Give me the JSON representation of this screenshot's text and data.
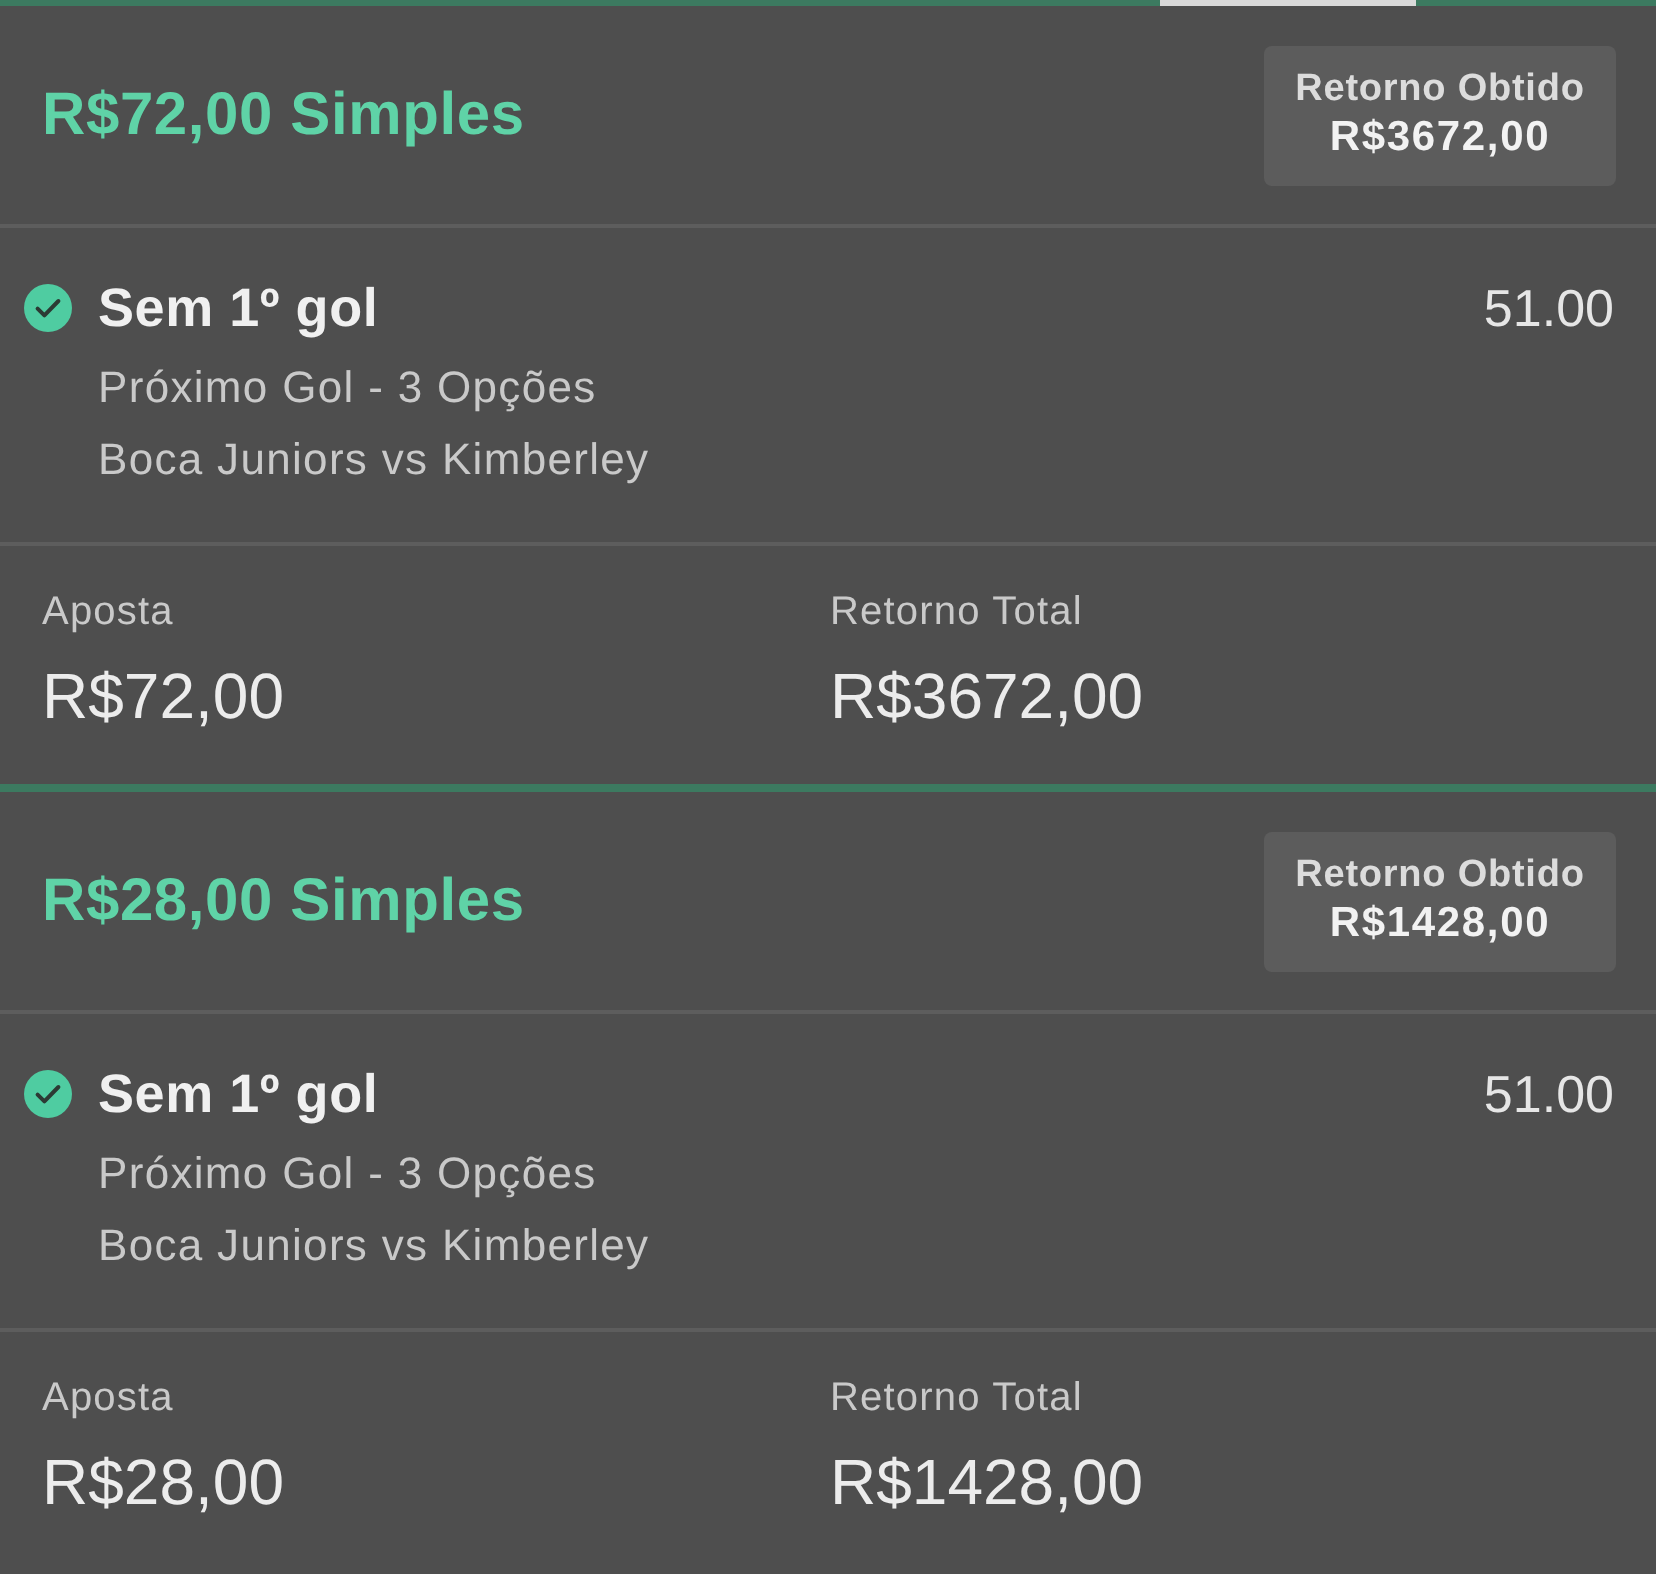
{
  "bets": [
    {
      "title": "R$72,00 Simples",
      "result_badge": {
        "label": "Retorno Obtido",
        "amount": "R$3672,00"
      },
      "selection": {
        "name": "Sem 1º gol",
        "won": true,
        "odds": "51.00",
        "market": "Próximo Gol - 3 Opções",
        "event": "Boca Juniors vs Kimberley"
      },
      "stake": {
        "label": "Aposta",
        "value": "R$72,00"
      },
      "total_return": {
        "label": "Retorno Total",
        "value": "R$3672,00"
      }
    },
    {
      "title": "R$28,00 Simples",
      "result_badge": {
        "label": "Retorno Obtido",
        "amount": "R$1428,00"
      },
      "selection": {
        "name": "Sem 1º gol",
        "won": true,
        "odds": "51.00",
        "market": "Próximo Gol - 3 Opções",
        "event": "Boca Juniors vs Kimberley"
      },
      "stake": {
        "label": "Aposta",
        "value": "R$28,00"
      },
      "total_return": {
        "label": "Retorno Total",
        "value": "R$1428,00"
      }
    }
  ]
}
